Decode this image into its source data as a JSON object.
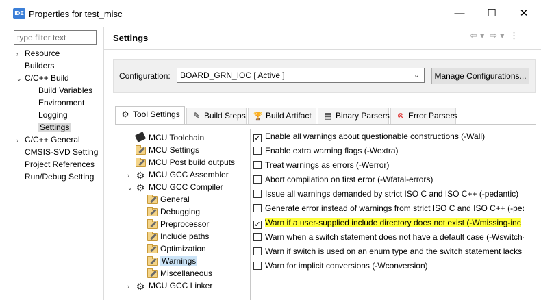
{
  "window": {
    "icon_text": "IDE",
    "title": "Properties for test_misc",
    "minimize": "—",
    "maximize": "☐",
    "close": "✕"
  },
  "filter": {
    "placeholder": "type filter text"
  },
  "left_tree": [
    {
      "label": "Resource",
      "twist": "›",
      "level": 0,
      "selected": false
    },
    {
      "label": "Builders",
      "twist": "",
      "level": 0,
      "selected": false
    },
    {
      "label": "C/C++ Build",
      "twist": "⌄",
      "level": 0,
      "selected": false
    },
    {
      "label": "Build Variables",
      "twist": "",
      "level": 1,
      "selected": false
    },
    {
      "label": "Environment",
      "twist": "",
      "level": 1,
      "selected": false
    },
    {
      "label": "Logging",
      "twist": "",
      "level": 1,
      "selected": false
    },
    {
      "label": "Settings",
      "twist": "",
      "level": 1,
      "selected": true
    },
    {
      "label": "C/C++ General",
      "twist": "›",
      "level": 0,
      "selected": false
    },
    {
      "label": "CMSIS-SVD Setting",
      "twist": "",
      "level": 0,
      "selected": false
    },
    {
      "label": "Project References",
      "twist": "",
      "level": 0,
      "selected": false
    },
    {
      "label": "Run/Debug Setting",
      "twist": "",
      "level": 0,
      "selected": false
    }
  ],
  "settings": {
    "title": "Settings",
    "nav": {
      "back": "⇦",
      "back_menu": "▾",
      "forward": "⇨",
      "forward_menu": "▾",
      "more": "⋮"
    }
  },
  "configuration": {
    "label": "Configuration:",
    "value": "BOARD_GRN_IOC  [ Active ]",
    "chevron": "⌄",
    "manage_label": "Manage Configurations..."
  },
  "tabs": [
    {
      "label": "Tool Settings",
      "icon": "⚙",
      "icon_name": "tool-settings-icon",
      "active": true
    },
    {
      "label": "Build Steps",
      "icon": "✎",
      "icon_name": "build-steps-icon",
      "active": false
    },
    {
      "label": "Build Artifact",
      "icon": "🏆",
      "icon_name": "build-artifact-icon",
      "active": false
    },
    {
      "label": "Binary Parsers",
      "icon": "▤",
      "icon_name": "binary-parsers-icon",
      "active": false
    },
    {
      "label": "Error Parsers",
      "icon": "⊗",
      "icon_name": "error-parsers-icon",
      "active": false
    }
  ],
  "tool_tree": [
    {
      "label": "MCU Toolchain",
      "twist": "",
      "level": 0,
      "icon": "chip",
      "selected": false
    },
    {
      "label": "MCU Settings",
      "twist": "",
      "level": 0,
      "icon": "folder",
      "selected": false
    },
    {
      "label": "MCU Post build outputs",
      "twist": "",
      "level": 0,
      "icon": "folder",
      "selected": false
    },
    {
      "label": "MCU GCC Assembler",
      "twist": "›",
      "level": 0,
      "icon": "gear",
      "selected": false
    },
    {
      "label": "MCU GCC Compiler",
      "twist": "⌄",
      "level": 0,
      "icon": "gear",
      "selected": false
    },
    {
      "label": "General",
      "twist": "",
      "level": 1,
      "icon": "folder",
      "selected": false
    },
    {
      "label": "Debugging",
      "twist": "",
      "level": 1,
      "icon": "folder",
      "selected": false
    },
    {
      "label": "Preprocessor",
      "twist": "",
      "level": 1,
      "icon": "folder",
      "selected": false
    },
    {
      "label": "Include paths",
      "twist": "",
      "level": 1,
      "icon": "folder",
      "selected": false
    },
    {
      "label": "Optimization",
      "twist": "",
      "level": 1,
      "icon": "folder",
      "selected": false
    },
    {
      "label": "Warnings",
      "twist": "",
      "level": 1,
      "icon": "folder",
      "selected": true
    },
    {
      "label": "Miscellaneous",
      "twist": "",
      "level": 1,
      "icon": "folder",
      "selected": false
    },
    {
      "label": "MCU GCC Linker",
      "twist": "›",
      "level": 0,
      "icon": "gear",
      "selected": false
    }
  ],
  "options": [
    {
      "label": "Enable all warnings about questionable constructions (-Wall)",
      "checked": true,
      "highlight": false
    },
    {
      "label": "Enable extra warning flags (-Wextra)",
      "checked": false,
      "highlight": false
    },
    {
      "label": "Treat warnings as errors (-Werror)",
      "checked": false,
      "highlight": false
    },
    {
      "label": "Abort compilation on first error (-Wfatal-errors)",
      "checked": false,
      "highlight": false
    },
    {
      "label": "Issue all warnings demanded by strict ISO C and ISO C++ (-pedantic)",
      "checked": false,
      "highlight": false
    },
    {
      "label": "Generate error instead of warnings from strict ISO C and ISO C++ (-ped",
      "checked": false,
      "highlight": false
    },
    {
      "label": "Warn if a user-supplied include directory does not exist (-Wmissing-inc",
      "checked": true,
      "highlight": true
    },
    {
      "label": "Warn when a switch statement does not have a default case (-Wswitch-",
      "checked": false,
      "highlight": false
    },
    {
      "label": "Warn if switch is used on an enum type and the switch statement lacks",
      "checked": false,
      "highlight": false
    },
    {
      "label": "Warn for implicit conversions (-Wconversion)",
      "checked": false,
      "highlight": false
    }
  ],
  "colors": {
    "highlight": "#ffff3c",
    "selection": "#cce4f7",
    "accent": "#3b7fd8"
  }
}
